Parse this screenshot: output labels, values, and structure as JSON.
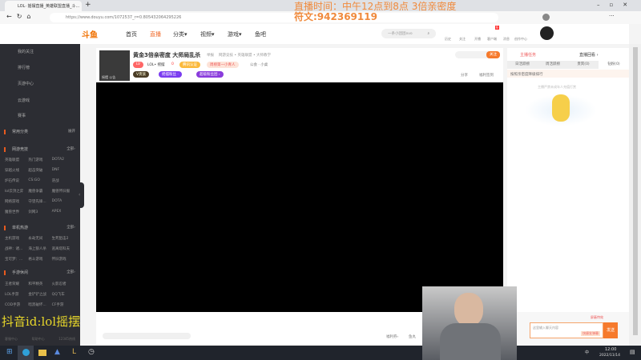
{
  "browser": {
    "tab_title": "LOL· 摇摆直播_英雄联盟直播_斗...",
    "url": "https://www.douyu.com/1072537_r=0.805432064295226"
  },
  "overlay": {
    "line1": "直播时间：中午12点到8点 3倍亲密度",
    "line2": "符文:942369119",
    "watermark": "抖音id:lol摇摆"
  },
  "header": {
    "logo": "斗鱼",
    "nav": [
      "首页",
      "直播",
      "分类▾",
      "视频▾",
      "游戏▾",
      "鱼吧"
    ],
    "search_placeholder": "一条小团团ovo",
    "icons": [
      "历史",
      "关注",
      "开播",
      "客户端",
      "消息",
      "创作中心"
    ],
    "badge": "9"
  },
  "sidebar": {
    "items": [
      "我的关注",
      "排行榜",
      "页游中心",
      "云游戏",
      "赛事"
    ],
    "common": "常用分类",
    "expand": "展开",
    "sections": [
      {
        "title": "网游竞技",
        "more": "全部›",
        "games": [
          "英雄联盟",
          "热门游戏",
          "DOTA2",
          "穿越火线",
          "超击突破",
          "DNF",
          "炉石传说",
          "CS:GO",
          "逆战",
          "lol云顶之弈",
          "魔兽争霸",
          "魔兽怀旧服",
          "网络游戏",
          "守望先锋...",
          "DOTA",
          "魔兽世界",
          "剑网3",
          "APEX"
        ]
      },
      {
        "title": "单机热游",
        "more": "全部›",
        "games": [
          "主机游戏",
          "永劫无间",
          "生死狙击2",
          "战神：诸...",
          "海上狼人杀",
          "逃离塔科夫",
          "宝可梦：...",
          "格斗游戏",
          "怀旧游戏"
        ]
      },
      {
        "title": "手游休闲",
        "more": "全部›",
        "games": [
          "王者荣耀",
          "和平精英",
          "火影忍者",
          "LOL手游",
          "金铲铲之战",
          "QQ飞车",
          "COD手游",
          "暗黑破坏...",
          "CF手游"
        ]
      }
    ],
    "footer": [
      "客服中心",
      "帮助中心",
      "12345热线"
    ]
  },
  "room": {
    "title": "黄金3倍亲密度 大师局乱杀",
    "tag1": "举报",
    "breadcrumb": "网游竞技 • 英雄联盟 • 大师教学",
    "level": "LV",
    "streamer": "LOL• 摇摆",
    "hot": "0",
    "badge1": "腾讯认证",
    "badge2": "周榜第一小青人",
    "notice": "公会 · 小桌",
    "vip": "V贵族",
    "fans": "摇摆粉丝 ·",
    "ranklist": "超级粉丝团 ›",
    "follow": "关注",
    "share": "分享",
    "report": "福利签到",
    "avatar_caption": "摇摆  公告",
    "welfare": "福利券›",
    "bottom_right": "鱼丸"
  },
  "right": {
    "tabs_top": [
      "主播任务",
      "直播回看 ›"
    ],
    "tabs": [
      "日活跃榜",
      "周活跃榜",
      "贵宾(0)",
      "钻粉(0)"
    ],
    "rank_title": "按照亲密度降级排行",
    "empty": "主播严禁未成年人充值打赏",
    "chat_placeholder": "这里输入聊天内容",
    "send": "发送",
    "block": "屏蔽特效",
    "quick": "快捷发弹幕"
  },
  "taskbar": {
    "time": "12:00",
    "date": "2022/11/14",
    "ime": "中"
  }
}
